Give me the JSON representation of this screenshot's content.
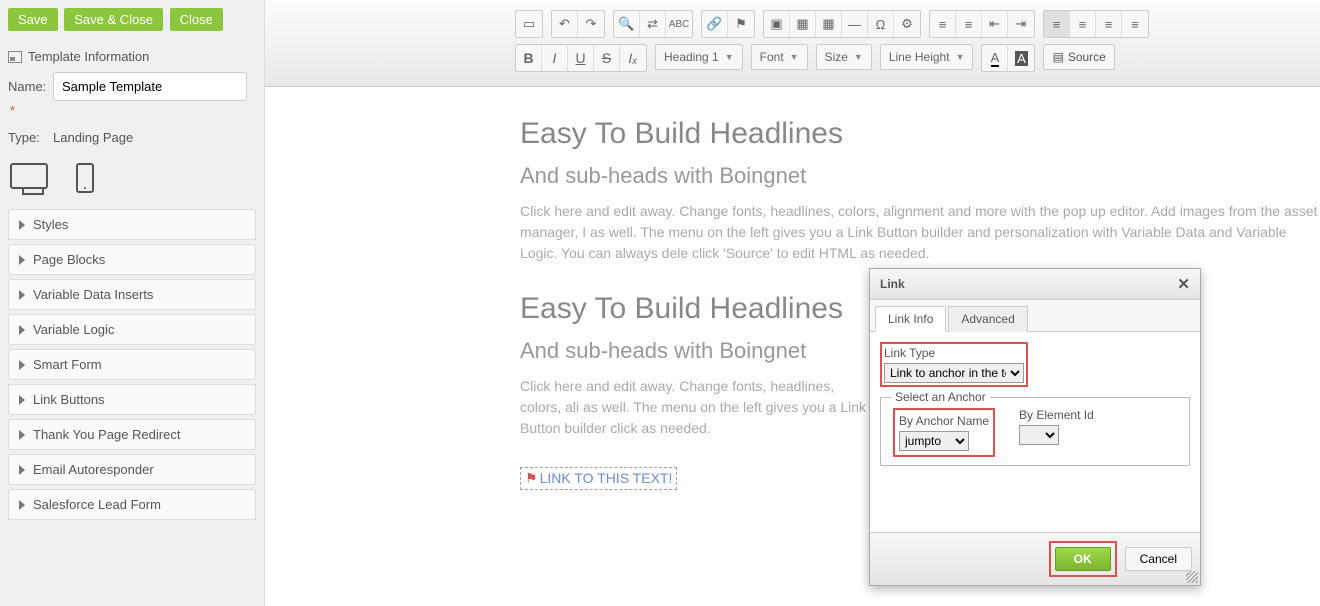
{
  "actions": {
    "save": "Save",
    "save_close": "Save & Close",
    "close": "Close"
  },
  "section_title": "Template Information",
  "form": {
    "name_label": "Name:",
    "name_value": "Sample Template",
    "type_label": "Type:",
    "type_value": "Landing Page"
  },
  "accordion": [
    "Styles",
    "Page Blocks",
    "Variable Data Inserts",
    "Variable Logic",
    "Smart Form",
    "Link Buttons",
    "Thank You Page Redirect",
    "Email Autoresponder",
    "Salesforce Lead Form"
  ],
  "toolbar": {
    "heading": "Heading 1",
    "font": "Font",
    "size": "Size",
    "line_height": "Line Height",
    "source": "Source",
    "bold": "B",
    "italic": "I",
    "underline": "U",
    "strike": "S",
    "clear_fmt": "Iₓ",
    "text_color": "A",
    "bg_color": "A"
  },
  "content": {
    "h1": "Easy To Build Headlines",
    "h2": "And sub-heads with Boingnet",
    "p1": "Click here and edit away. Change fonts, headlines, colors, alignment and more with the pop up editor. Add images from the asset manager, I as well. The menu on the left gives you a Link Button builder and personalization with Variable Data and Variable Logic. You can always dele click 'Source' to edit HTML as needed.",
    "p2": "Click here and edit away. Change fonts, headlines, colors, ali   as well. The menu on the left gives you a Link Button builder   click as needed.",
    "anchor_text": "LINK TO THIS TEXT!"
  },
  "dialog": {
    "title": "Link",
    "tabs": {
      "info": "Link Info",
      "advanced": "Advanced"
    },
    "link_type_label": "Link Type",
    "link_type_value": "Link to anchor in the text",
    "fieldset_legend": "Select an Anchor",
    "by_name_label": "By Anchor Name",
    "by_name_value": "jumpto",
    "by_id_label": "By Element Id",
    "ok": "OK",
    "cancel": "Cancel"
  }
}
